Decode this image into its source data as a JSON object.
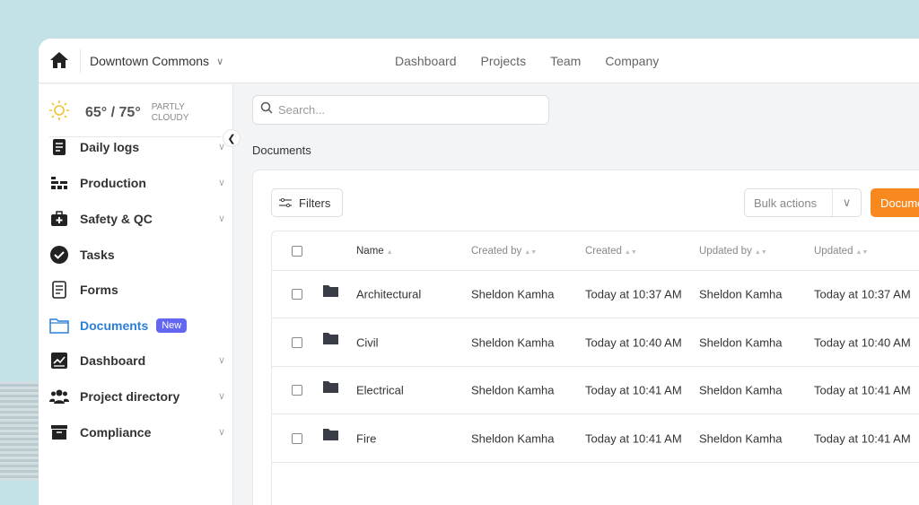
{
  "header": {
    "project": "Downtown Commons",
    "nav": [
      "Dashboard",
      "Projects",
      "Team",
      "Company"
    ]
  },
  "weather": {
    "temp": "65° / 75°",
    "condition_line1": "PARTLY",
    "condition_line2": "CLOUDY"
  },
  "sidebar": {
    "items": [
      {
        "label": "Daily logs",
        "icon": "daily-log-icon",
        "chevron": true
      },
      {
        "label": "Production",
        "icon": "production-icon",
        "chevron": true
      },
      {
        "label": "Safety & QC",
        "icon": "first-aid-icon",
        "chevron": true
      },
      {
        "label": "Tasks",
        "icon": "check-circle-icon",
        "chevron": false
      },
      {
        "label": "Forms",
        "icon": "form-icon",
        "chevron": false
      },
      {
        "label": "Documents",
        "icon": "folder-icon",
        "chevron": false,
        "active": true,
        "badge": "New"
      },
      {
        "label": "Dashboard",
        "icon": "chart-icon",
        "chevron": true
      },
      {
        "label": "Project directory",
        "icon": "people-icon",
        "chevron": true
      },
      {
        "label": "Compliance",
        "icon": "archive-icon",
        "chevron": true
      }
    ]
  },
  "search": {
    "placeholder": "Search..."
  },
  "breadcrumb": "Documents",
  "toolbar": {
    "filters": "Filters",
    "bulk_actions": "Bulk actions",
    "primary": "Documents"
  },
  "table": {
    "columns": [
      "Name",
      "Created by",
      "Created",
      "Updated by",
      "Updated"
    ],
    "rows": [
      [
        "Architectural",
        "Sheldon Kamha",
        "Today at 10:37 AM",
        "Sheldon Kamha",
        "Today at 10:37 AM"
      ],
      [
        "Civil",
        "Sheldon Kamha",
        "Today at 10:40 AM",
        "Sheldon Kamha",
        "Today at 10:40 AM"
      ],
      [
        "Electrical",
        "Sheldon Kamha",
        "Today at 10:41 AM",
        "Sheldon Kamha",
        "Today at 10:41 AM"
      ],
      [
        "Fire",
        "Sheldon Kamha",
        "Today at 10:41 AM",
        "Sheldon Kamha",
        "Today at 10:41 AM"
      ]
    ]
  },
  "colors": {
    "accent": "#2b7fd8",
    "primary": "#f7891f",
    "badge": "#6366f1"
  }
}
